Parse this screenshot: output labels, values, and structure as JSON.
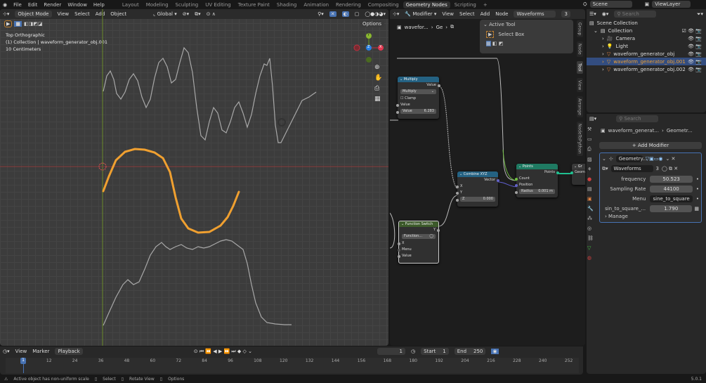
{
  "menu": {
    "items": [
      "File",
      "Edit",
      "Render",
      "Window",
      "Help"
    ],
    "workspaces": [
      "Layout",
      "Modeling",
      "Sculpting",
      "UV Editing",
      "Texture Paint",
      "Shading",
      "Animation",
      "Rendering",
      "Compositing",
      "Geometry Nodes",
      "Scripting"
    ],
    "active_workspace": "Geometry Nodes",
    "scene": "Scene",
    "view_layer": "ViewLayer"
  },
  "viewport": {
    "mode": "Object Mode",
    "menus": [
      "View",
      "Select",
      "Add",
      "Object"
    ],
    "orientation": "Global",
    "options": "Options",
    "overlay_lines": [
      "Top Orthographic",
      "(1) Collection | waveform_generator_obj.001",
      "10 Centimeters"
    ],
    "gizmo": {
      "y": "Y",
      "z": "Z",
      "x": "X"
    },
    "selected_curve_color": "#f0a030"
  },
  "node_editor": {
    "editor": "Modifier",
    "menus": [
      "View",
      "Select",
      "Add",
      "Node"
    ],
    "node_group": "Waveforms",
    "users": "3",
    "breadcrumb": [
      "wavefor...",
      "Ge"
    ],
    "active_tool": {
      "title": "Active Tool",
      "tool": "Select Box"
    },
    "side_tabs": [
      "Group",
      "Node",
      "Tool",
      "View",
      "Arrange",
      "NodeToPython"
    ],
    "nodes": {
      "multiply": {
        "title": "Multiply",
        "output": "Value",
        "operation": "Multiply",
        "clamp": "Clamp",
        "input": "Value",
        "value_label": "Value",
        "value": "6.283"
      },
      "combine": {
        "title": "Combine XYZ",
        "output": "Vector",
        "x": "X",
        "y": "Y",
        "z_label": "Z",
        "z": "0.000"
      },
      "points": {
        "title": "Points",
        "output": "Points",
        "count": "Count",
        "position": "Position",
        "radius_label": "Radius",
        "radius": "0.001 m"
      },
      "function_switch": {
        "title": "Function Switch",
        "output": "Y",
        "selector": "Function...",
        "x": "X",
        "menu": "Menu",
        "value": "Value"
      },
      "group_output": {
        "title": "Gr",
        "input": "Geom"
      }
    }
  },
  "outliner": {
    "search_placeholder": "Search",
    "root": "Scene Collection",
    "collection": "Collection",
    "items": [
      {
        "name": "Camera",
        "selected": false
      },
      {
        "name": "Light",
        "selected": false
      },
      {
        "name": "waveform_generator_obj",
        "selected": false
      },
      {
        "name": "waveform_generator_obj.001",
        "selected": true
      },
      {
        "name": "waveform_generator_obj.002",
        "selected": false
      }
    ]
  },
  "properties": {
    "search_placeholder": "Search",
    "breadcrumb": [
      "waveform_generat...",
      "Geometr..."
    ],
    "add_modifier": "Add Modifier",
    "modifier_name": "Geometry...",
    "node_group": "Waveforms",
    "users": "3",
    "fields": [
      {
        "label": "frequency",
        "value": "50.523"
      },
      {
        "label": "Sampling Rate",
        "value": "44100"
      },
      {
        "label": "Menu",
        "value": "sine_to_square"
      },
      {
        "label": "sin_to_square_...",
        "value": "1.790"
      }
    ],
    "manage": "Manage"
  },
  "timeline": {
    "menus": [
      "View",
      "Marker",
      "Playback"
    ],
    "current_frame": "1",
    "start_label": "Start",
    "start": "1",
    "end_label": "End",
    "end": "250",
    "ticks": [
      "1",
      "12",
      "24",
      "36",
      "48",
      "60",
      "72",
      "84",
      "96",
      "108",
      "120",
      "132",
      "144",
      "156",
      "168",
      "180",
      "192",
      "204",
      "216",
      "228",
      "240",
      "252"
    ]
  },
  "status": {
    "warning": "Active object has non-uniform scale",
    "select": "Select",
    "rotate": "Rotate View",
    "options": "Options",
    "version": "5.0.1"
  }
}
